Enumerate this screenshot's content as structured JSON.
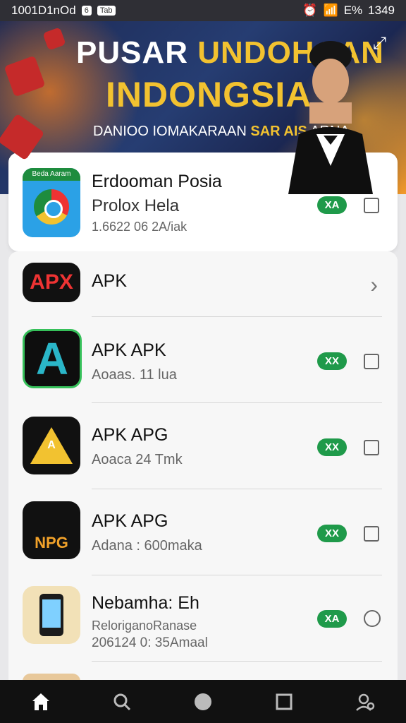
{
  "status": {
    "left_text": "1001D1nOd",
    "pill1": "6",
    "pill2": "Tab",
    "battery": "E%",
    "time": "1349"
  },
  "banner": {
    "title_part1": "PUSAR ",
    "title_part2": "UNDOHAAN",
    "title_line2": "INDONGSIA",
    "subtitle_part1": "DANIOO IOMAKARAAN ",
    "subtitle_part2": "SAR AIS",
    "subtitle_part3": " ARNA"
  },
  "top_item": {
    "icon_label": "Beda Aaram",
    "title": "Erdooman Posia",
    "sub": "Prolox Hela",
    "meta": "1.6622 06 2A/iak",
    "badge": "XA"
  },
  "items": [
    {
      "title": "APK",
      "sub": "",
      "badge": "",
      "control": "chevron",
      "icon_text": "APX"
    },
    {
      "title": "APK APK",
      "sub": "Aoaas. 11 lua",
      "badge": "XX",
      "control": "checkbox",
      "icon_text": "A"
    },
    {
      "title": "APK APG",
      "sub": "Aoaca 24 Tmk",
      "badge": "XX",
      "control": "checkbox",
      "icon_text": "A"
    },
    {
      "title": "APK APG",
      "sub": "Adana : 600maka",
      "badge": "XX",
      "control": "checkbox",
      "icon_text": "NPG"
    },
    {
      "title": "Nebamha: Eh",
      "sub": "ReloriganoRanase",
      "sub2": "206124 0: 35Amaal",
      "badge": "XA",
      "control": "radio",
      "icon_text": ""
    }
  ],
  "nav": [
    "home-icon",
    "search-icon",
    "circle-icon",
    "square-icon",
    "user-icon"
  ]
}
